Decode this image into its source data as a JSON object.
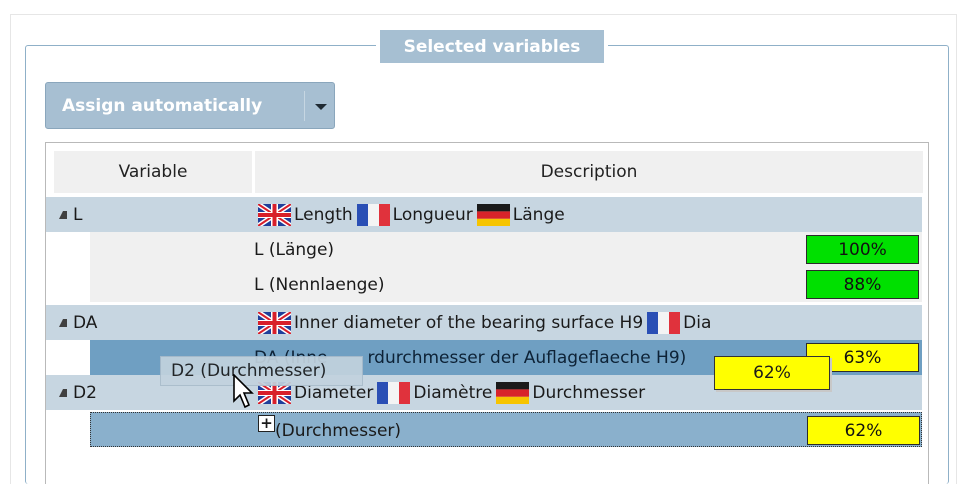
{
  "group_title": "Selected variables",
  "assign_button_label": "Assign automatically",
  "columns": {
    "variable": "Variable",
    "description": "Description"
  },
  "rows": [
    {
      "type": "parent",
      "variable": "L",
      "description": [
        {
          "flag": "uk-flag"
        },
        {
          "text": "Length"
        },
        {
          "flag": "fr-flag"
        },
        {
          "text": "Longueur"
        },
        {
          "flag": "de-flag"
        },
        {
          "text": "Länge"
        }
      ]
    },
    {
      "type": "child",
      "label": "L (Länge)",
      "percent": "100%",
      "color": "#00e000"
    },
    {
      "type": "child",
      "label": "L (Nennlaenge)",
      "percent": "88%",
      "color": "#00e000"
    },
    {
      "type": "parent",
      "variable": "DA",
      "description": [
        {
          "flag": "uk-flag"
        },
        {
          "text": "Inner diameter of the bearing surface H9"
        },
        {
          "flag": "fr-flag"
        },
        {
          "text": "Dia"
        }
      ]
    },
    {
      "type": "child",
      "label": "DA (Innendurchmesser der Auflageflaeche H9)",
      "percent": "63%",
      "color": "#ffff00"
    },
    {
      "type": "parent",
      "variable": "D2",
      "description": [
        {
          "flag": "uk-flag"
        },
        {
          "text": "Diameter"
        },
        {
          "flag": "fr-flag"
        },
        {
          "text": "Diamètre"
        },
        {
          "flag": "de-flag"
        },
        {
          "text": "Durchmesser"
        }
      ]
    },
    {
      "type": "child",
      "label": "D2 (Durchmesser)",
      "percent": "62%",
      "color": "#ffff00"
    }
  ],
  "drag_ghost": {
    "label": "D2 (Durchmesser)",
    "percent": "62%"
  },
  "visible_text": {
    "da_child_visible": "DA (Inne",
    "da_child_tail": "rdurchmesser der Auflageflaeche H9)",
    "d2_child_visible": "(Durchmesser)",
    "d2_desc_diameter": "Diameter"
  }
}
